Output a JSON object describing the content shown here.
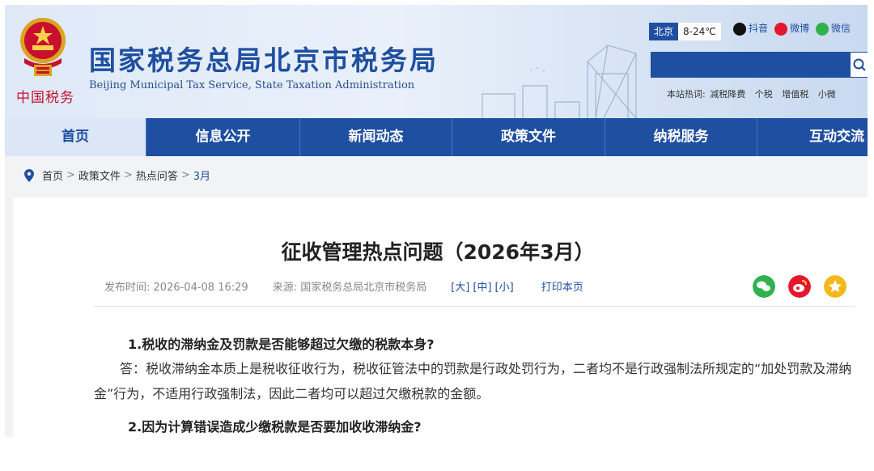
{
  "header": {
    "site_title": "国家税务总局北京市税务局",
    "site_subtitle": "Beijing Municipal Tax Service, State Taxation Administration",
    "logo_text": "中国税务",
    "weather": {
      "city": "北京",
      "temp": "8-24℃"
    },
    "social": {
      "douyin": "抖音",
      "weibo": "微博",
      "wechat": "微信"
    },
    "search": {
      "placeholder": ""
    },
    "hot": {
      "label": "本站热词:",
      "terms": [
        "减税降费",
        "个税",
        "增值税",
        "小微"
      ]
    }
  },
  "nav": {
    "items": [
      "首页",
      "信息公开",
      "新闻动态",
      "政策文件",
      "纳税服务",
      "互动交流"
    ]
  },
  "breadcrumb": {
    "items": [
      "首页",
      "政策文件",
      "热点问答"
    ],
    "current": "3月",
    "separator": ">"
  },
  "article": {
    "title": "征收管理热点问题（2026年3月）",
    "meta": {
      "date_label": "发布时间:",
      "date": "2026-04-08 16:29",
      "source_label": "来源:",
      "source": "国家税务总局北京市税务局",
      "sizes": [
        "[大]",
        "[中]",
        "[小]"
      ],
      "print": "打印本页"
    },
    "q1": "1.税收的滞纳金及罚款是否能够超过欠缴的税款本身?",
    "a1": "答：税收滞纳金本质上是税收征收行为，税收征管法中的罚款是行政处罚行为，二者均不是行政强制法所规定的“加处罚款及滞纳金”行为，不适用行政强制法，因此二者均可以超过欠缴税款的金额。",
    "q2": "2.因为计算错误造成少缴税款是否要加收收滞纳金?"
  },
  "colors": {
    "brand_blue": "#1f4fa0",
    "nav_active_bg": "#dbe6f6",
    "red": "#c8102e"
  },
  "icons": {
    "location": "location-pin-icon",
    "wechat": "wechat-icon",
    "weibo": "weibo-icon",
    "favorite": "star-icon",
    "search": "search-icon"
  }
}
